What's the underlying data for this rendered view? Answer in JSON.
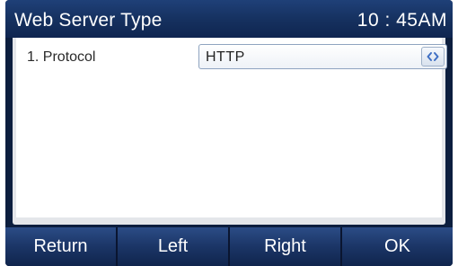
{
  "titlebar": {
    "title": "Web Server Type",
    "time": "10 : 45AM"
  },
  "settings": {
    "rows": [
      {
        "label": "1. Protocol",
        "value": "HTTP",
        "control_icon": "left-right-arrows-icon"
      }
    ]
  },
  "softkeys": [
    {
      "label": "Return"
    },
    {
      "label": "Left"
    },
    {
      "label": "Right"
    },
    {
      "label": "OK"
    }
  ],
  "colors": {
    "titlebar": "#1f4078",
    "softkey": "#1b3566",
    "arrow_accent": "#3f6fc4",
    "content_background": "#ffffff"
  }
}
